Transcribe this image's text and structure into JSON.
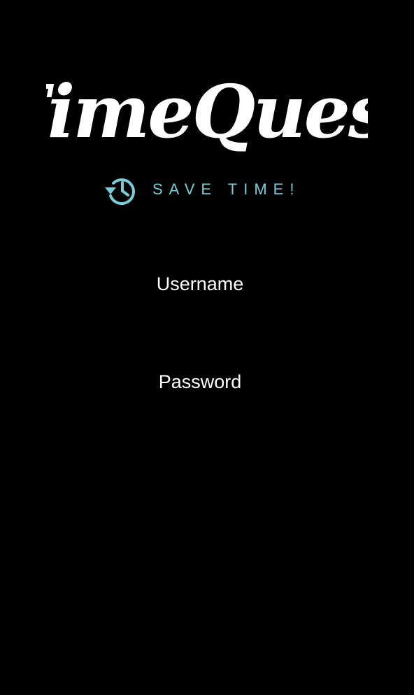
{
  "app": {
    "logo_text": "TimeQuest",
    "tagline": "SAVE TIME!",
    "logo_icon": "history-icon"
  },
  "form": {
    "username_placeholder": "Username",
    "password_placeholder": "Password"
  },
  "colors": {
    "background": "#000000",
    "logo": "#ffffff",
    "accent": "#7ccbd6",
    "field_text": "#ffffff"
  }
}
